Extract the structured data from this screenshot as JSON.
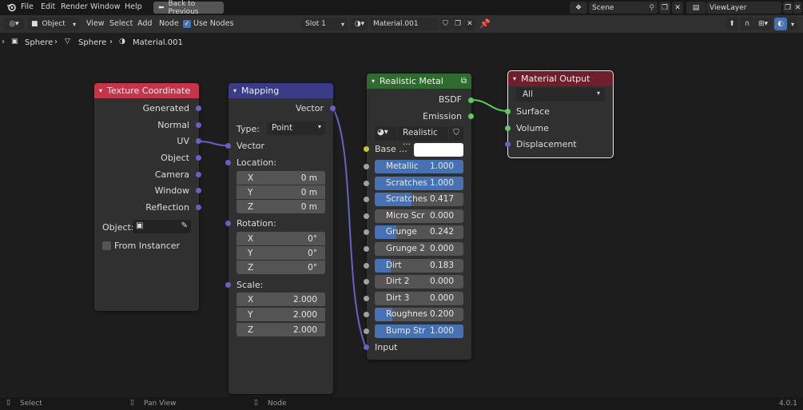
{
  "menu": {
    "file": "File",
    "edit": "Edit",
    "render": "Render",
    "window": "Window",
    "help": "Help",
    "back": "Back to Previous"
  },
  "scene": {
    "label": "Scene",
    "view_layer": "ViewLayer"
  },
  "header": {
    "mode": "Object",
    "view": "View",
    "select": "Select",
    "add": "Add",
    "node": "Node",
    "use_nodes": "Use Nodes",
    "slot": "Slot 1",
    "material": "Material.001"
  },
  "breadcrumb": {
    "object": "Sphere",
    "mesh": "Sphere",
    "material": "Material.001"
  },
  "nodes": {
    "texcoord": {
      "title": "Texture Coordinate",
      "outputs": [
        "Generated",
        "Normal",
        "UV",
        "Object",
        "Camera",
        "Window",
        "Reflection"
      ],
      "object_label": "Object:",
      "from_instancer": "From Instancer"
    },
    "mapping": {
      "title": "Mapping",
      "output": "Vector",
      "type_label": "Type:",
      "type_value": "Point",
      "vector_in": "Vector",
      "location_label": "Location:",
      "location": [
        {
          "axis": "X",
          "value": "0 m"
        },
        {
          "axis": "Y",
          "value": "0 m"
        },
        {
          "axis": "Z",
          "value": "0 m"
        }
      ],
      "rotation_label": "Rotation:",
      "rotation": [
        {
          "axis": "X",
          "value": "0°"
        },
        {
          "axis": "Y",
          "value": "0°"
        },
        {
          "axis": "Z",
          "value": "0°"
        }
      ],
      "scale_label": "Scale:",
      "scale": [
        {
          "axis": "X",
          "value": "2.000"
        },
        {
          "axis": "Y",
          "value": "2.000"
        },
        {
          "axis": "Z",
          "value": "2.000"
        }
      ]
    },
    "metal": {
      "title": "Realistic Metal",
      "out_bsdf": "BSDF",
      "out_emission": "Emission",
      "group_name": "Realistic ...",
      "base_label": "Base ...",
      "sliders": [
        {
          "label": "Metallic",
          "value": "1.000",
          "fill": 1.0
        },
        {
          "label": "Scratches",
          "value": "1.000",
          "fill": 1.0
        },
        {
          "label": "Scratches",
          "value": "0.417",
          "fill": 0.417
        },
        {
          "label": "Micro Scr",
          "value": "0.000",
          "fill": 0.0
        },
        {
          "label": "Grunge",
          "value": "0.242",
          "fill": 0.242
        },
        {
          "label": "Grunge 2",
          "value": "0.000",
          "fill": 0.0
        },
        {
          "label": "Dirt",
          "value": "0.183",
          "fill": 0.183
        },
        {
          "label": "Dirt 2",
          "value": "0.000",
          "fill": 0.0
        },
        {
          "label": "Dirt 3",
          "value": "0.000",
          "fill": 0.0
        },
        {
          "label": "Roughnes",
          "value": "0.200",
          "fill": 0.2
        },
        {
          "label": "Bump Str",
          "value": "1.000",
          "fill": 1.0
        }
      ],
      "input_label": "Input"
    },
    "output": {
      "title": "Material Output",
      "target": "All",
      "inputs": [
        "Surface",
        "Volume",
        "Displacement"
      ]
    }
  },
  "status": {
    "select": "Select",
    "pan": "Pan View",
    "node": "Node",
    "version": "4.0.1"
  },
  "colors": {
    "texcoord_header": "#c4344a",
    "mapping_header": "#3b3b87",
    "metal_header": "#2f6b2f",
    "output_header": "#6e1f2b",
    "accent": "#4672b4"
  }
}
